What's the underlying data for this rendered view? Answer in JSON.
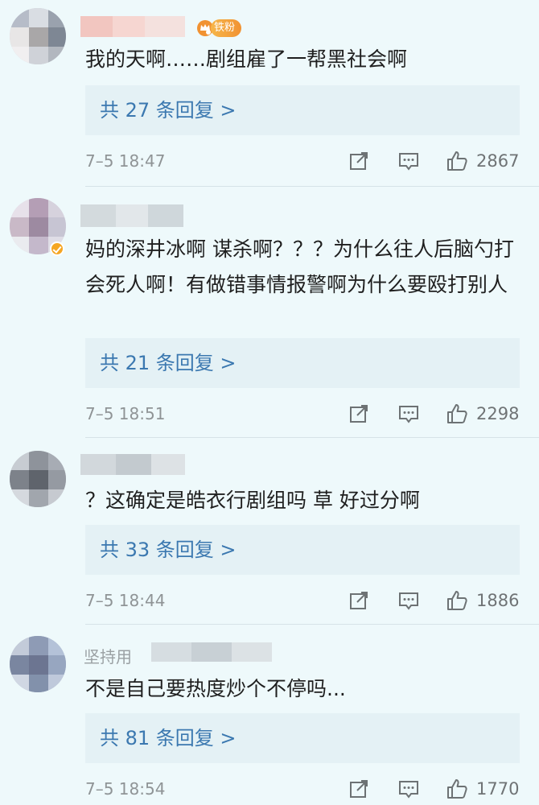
{
  "comments": [
    {
      "badge": "铁粉",
      "text": "我的天啊……剧组雇了一帮黑社会啊",
      "replies": "共 27 条回复 >",
      "time": "7–5 18:47",
      "likes": "2867"
    },
    {
      "text": "妈的深井冰啊 谋杀啊？？？为什么往人后脑勺打 会死人啊！有做错事情报警啊为什么要殴打别人",
      "replies": "共 21 条回复 >",
      "time": "7–5 18:51",
      "likes": "2298"
    },
    {
      "text": "？这确定是皓衣行剧组吗 草 好过分啊",
      "replies": "共 33 条回复 >",
      "time": "7–5 18:44",
      "likes": "1886"
    },
    {
      "name_partial": "坚持用",
      "text": "不是自己要热度炒个不停吗...",
      "replies": "共 81 条回复 >",
      "time": "7–5 18:54",
      "likes": "1770"
    }
  ],
  "icons": {
    "share": "share-icon",
    "comment": "comment-icon",
    "like": "thumbs-up-icon",
    "crown": "crown-icon",
    "verified": "verified-icon"
  },
  "colors": {
    "background": "#eef9fb",
    "reply_link": "#3b78b0",
    "reply_box": "#e4f1f5",
    "meta": "#8f9496",
    "fan_badge": "#f19232",
    "verified": "#f5a623"
  }
}
